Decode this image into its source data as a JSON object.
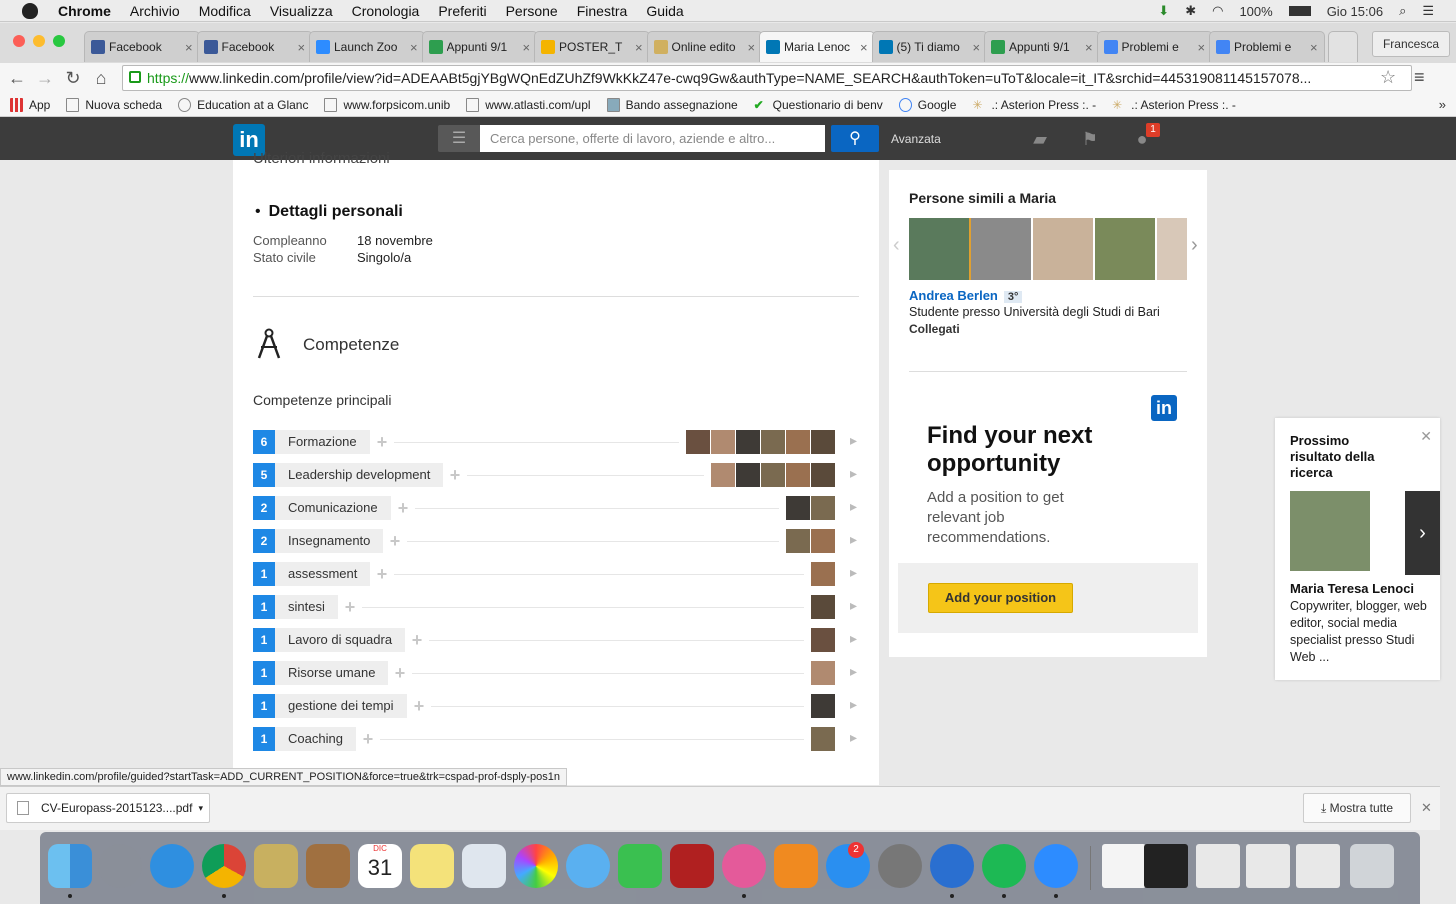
{
  "menubar": {
    "app": "Chrome",
    "items": [
      "Archivio",
      "Modifica",
      "Visualizza",
      "Cronologia",
      "Preferiti",
      "Persone",
      "Finestra",
      "Guida"
    ],
    "battery": "100%",
    "clock": "Gio 15:06"
  },
  "tabs": [
    {
      "title": "Facebook",
      "icon": "facebook-icon",
      "color": "#3b5998"
    },
    {
      "title": "Facebook",
      "icon": "facebook-icon",
      "color": "#3b5998"
    },
    {
      "title": "Launch Zoo",
      "icon": "zoom-icon",
      "color": "#2d8cff"
    },
    {
      "title": "Appunti 9/1",
      "icon": "drive-icon",
      "color": "#2e9e4f"
    },
    {
      "title": "POSTER_T",
      "icon": "slides-icon",
      "color": "#f4b400"
    },
    {
      "title": "Online edito",
      "icon": "editor-icon",
      "color": "#d0b060"
    },
    {
      "title": "Maria Lenoc",
      "icon": "linkedin-icon",
      "color": "#0077b5",
      "active": true
    },
    {
      "title": "(5) Ti diamo",
      "icon": "linkedin-icon",
      "color": "#0077b5"
    },
    {
      "title": "Appunti 9/1",
      "icon": "drive-icon",
      "color": "#2e9e4f"
    },
    {
      "title": "Problemi e",
      "icon": "docs-icon",
      "color": "#4285f4"
    },
    {
      "title": "Problemi e",
      "icon": "docs-icon",
      "color": "#4285f4"
    }
  ],
  "profile_button": "Francesca",
  "url": {
    "scheme": "https://",
    "rest": "www.linkedin.com/profile/view?id=ADEAABt5gjYBgWQnEdZUhZf9WkKkZ47e-cwq9Gw&authType=NAME_SEARCH&authToken=uToT&locale=it_IT&srchid=445319081145157078..."
  },
  "bookmarks": [
    "App",
    "Nuova scheda",
    "Education at a Glanc",
    "www.forpsicom.unib",
    "www.atlasti.com/upl",
    "Bando assegnazione",
    "Questionario di benv",
    "Google",
    ".: Asterion Press :. -",
    ".: Asterion Press :. -"
  ],
  "linkedin": {
    "search_placeholder": "Cerca persone, offerte di lavoro, aziende e altro...",
    "advanced": "Avanzata",
    "notif_count": "1"
  },
  "profile": {
    "cut_heading": "Ulteriori informazioni",
    "details_heading": "Dettagli personali",
    "birthday_label": "Compleanno",
    "birthday_value": "18 novembre",
    "status_label": "Stato civile",
    "status_value": "Singolo/a",
    "skills_title": "Competenze",
    "skills_subtitle": "Competenze principali",
    "skills": [
      {
        "count": "6",
        "name": "Formazione",
        "faces": 6
      },
      {
        "count": "5",
        "name": "Leadership development",
        "faces": 5
      },
      {
        "count": "2",
        "name": "Comunicazione",
        "faces": 2
      },
      {
        "count": "2",
        "name": "Insegnamento",
        "faces": 2
      },
      {
        "count": "1",
        "name": "assessment",
        "faces": 1
      },
      {
        "count": "1",
        "name": "sintesi",
        "faces": 1
      },
      {
        "count": "1",
        "name": "Lavoro di squadra",
        "faces": 1
      },
      {
        "count": "1",
        "name": "Risorse umane",
        "faces": 1
      },
      {
        "count": "1",
        "name": "gestione dei tempi",
        "faces": 1
      },
      {
        "count": "1",
        "name": "Coaching",
        "faces": 1
      }
    ]
  },
  "similar": {
    "title": "Persone simili a Maria",
    "name": "Andrea Berlen",
    "degree": "3°",
    "desc": "Studente presso Università degli Studi di Bari",
    "connect": "Collegati"
  },
  "ad": {
    "title": "Find your next opportunity",
    "text": "Add a position to get relevant job recommendations.",
    "button": "Add your position"
  },
  "next": {
    "title": "Prossimo risultato della ricerca",
    "name": "Maria Teresa Lenoci",
    "desc": "Copywriter, blogger, web editor, social media specialist presso Studi Web ..."
  },
  "status_url": "www.linkedin.com/profile/guided?startTask=ADD_CURRENT_POSITION&force=true&trk=cspad-prof-dsply-pos1n",
  "downloads": {
    "file": "CV-Europass-2015123....pdf",
    "show_all": "Mostra tutte"
  },
  "dock": {
    "calendar_month": "DIC",
    "calendar_day": "31",
    "appstore_badge": "2"
  }
}
